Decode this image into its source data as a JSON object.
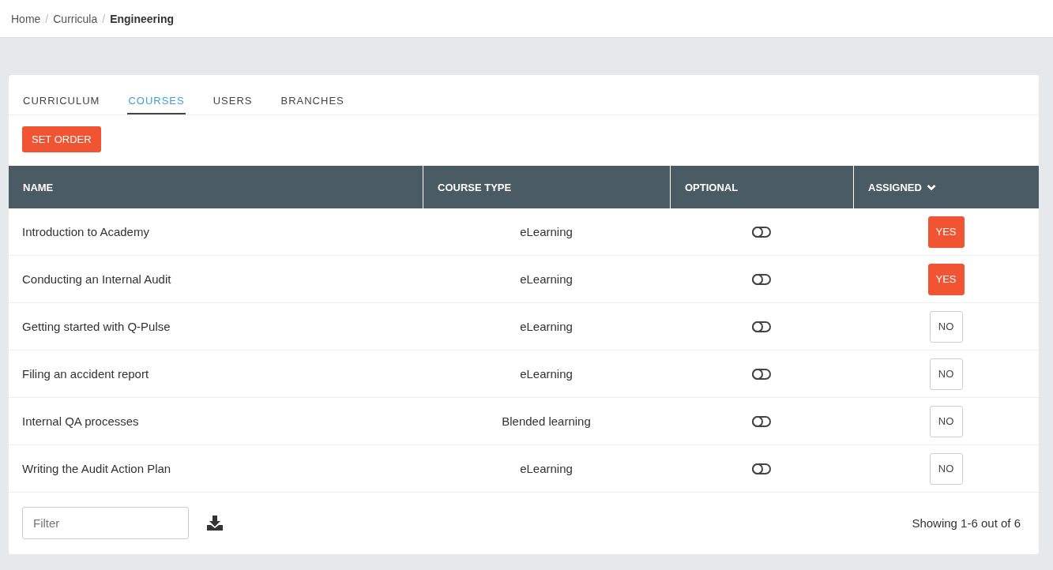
{
  "breadcrumb": [
    {
      "label": "Home",
      "current": false
    },
    {
      "label": "Curricula",
      "current": false
    },
    {
      "label": "Engineering",
      "current": true
    }
  ],
  "breadcrumb_separator": "/",
  "tabs": [
    {
      "label": "CURRICULUM",
      "selected": false
    },
    {
      "label": "COURSES",
      "selected": true
    },
    {
      "label": "USERS",
      "selected": false
    },
    {
      "label": "BRANCHES",
      "selected": false
    }
  ],
  "set_order_button": "SET ORDER",
  "table": {
    "columns": [
      {
        "label": "NAME",
        "sorted": false
      },
      {
        "label": "COURSE TYPE",
        "sorted": false
      },
      {
        "label": "OPTIONAL",
        "sorted": false
      },
      {
        "label": "ASSIGNED",
        "sorted": true
      }
    ],
    "rows": [
      {
        "name": "Introduction to Academy",
        "type": "eLearning",
        "optional": false,
        "assigned": true,
        "assigned_label": "YES"
      },
      {
        "name": "Conducting an Internal Audit",
        "type": "eLearning",
        "optional": false,
        "assigned": true,
        "assigned_label": "YES"
      },
      {
        "name": "Getting started with Q-Pulse",
        "type": "eLearning",
        "optional": false,
        "assigned": false,
        "assigned_label": "NO"
      },
      {
        "name": "Filing an accident report",
        "type": "eLearning",
        "optional": false,
        "assigned": false,
        "assigned_label": "NO"
      },
      {
        "name": "Internal QA processes",
        "type": "Blended learning",
        "optional": false,
        "assigned": false,
        "assigned_label": "NO"
      },
      {
        "name": "Writing the Audit Action Plan",
        "type": "eLearning",
        "optional": false,
        "assigned": false,
        "assigned_label": "NO"
      }
    ]
  },
  "filter": {
    "placeholder": "Filter"
  },
  "pagination": "Showing 1-6 out of 6"
}
